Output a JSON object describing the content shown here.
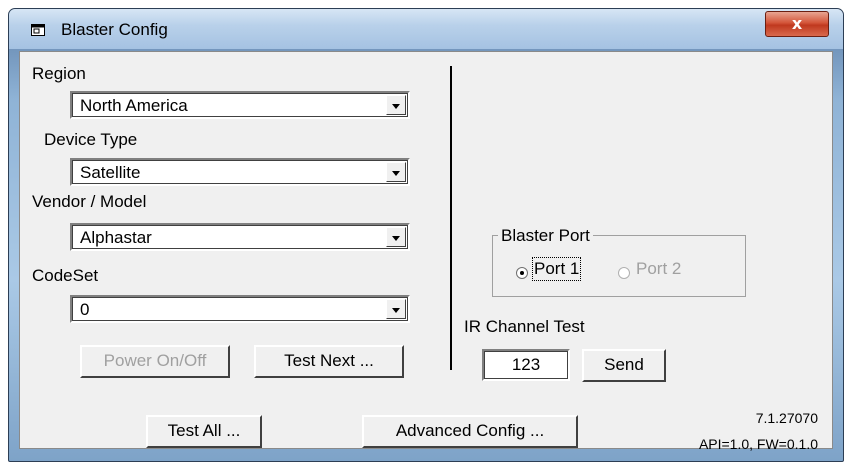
{
  "window": {
    "title": "Blaster Config",
    "close_glyph": "x",
    "icon": "window-app-icon"
  },
  "left": {
    "region": {
      "label": "Region",
      "value": "North America"
    },
    "device_type": {
      "label": "Device Type",
      "value": "Satellite"
    },
    "vendor_model": {
      "label": "Vendor / Model",
      "value": "Alphastar"
    },
    "codeset": {
      "label": "CodeSet",
      "value": "0"
    },
    "power_button": "Power On/Off",
    "test_next_button": "Test Next ..."
  },
  "right": {
    "blaster_port": {
      "title": "Blaster Port",
      "port1": "Port 1",
      "port2": "Port 2",
      "selected": "Port 1"
    },
    "ir_test": {
      "label": "IR Channel Test",
      "channel": "123",
      "send_button": "Send"
    }
  },
  "footer": {
    "test_all_button": "Test All ...",
    "advanced_button": "Advanced Config ...",
    "version": "7.1.27070",
    "api_fw": "API=1.0, FW=0.1.0"
  }
}
